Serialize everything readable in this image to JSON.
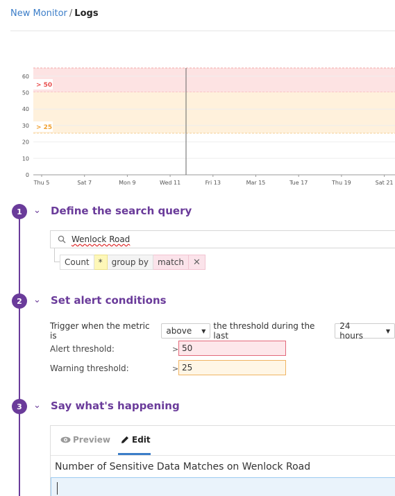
{
  "breadcrumb": {
    "parent": "New Monitor",
    "separator": "/",
    "current": "Logs"
  },
  "chart": {
    "y_ticks": [
      "0",
      "10",
      "20",
      "30",
      "40",
      "50",
      "60"
    ],
    "x_labels": [
      "Thu 5",
      "Sat 7",
      "Mon 9",
      "Wed 11",
      "Fri 13",
      "Mar 15",
      "Tue 17",
      "Thu 19",
      "Sat 21"
    ],
    "alert_label": "> 50",
    "warning_label": "> 25",
    "alert_color": "#e8504f",
    "warning_color": "#f0a030"
  },
  "chart_data": {
    "type": "line",
    "categories": [
      "Thu 5",
      "Sat 7",
      "Mon 9",
      "Wed 11",
      "Fri 13",
      "Mar 15",
      "Tue 17",
      "Thu 19",
      "Sat 21"
    ],
    "ylim": [
      0,
      65
    ],
    "series": [],
    "thresholds": {
      "alert": 50,
      "warning": 25
    }
  },
  "steps": [
    {
      "number": "1",
      "title": "Define the search query"
    },
    {
      "number": "2",
      "title": "Set alert conditions"
    },
    {
      "number": "3",
      "title": "Say what's happening"
    }
  ],
  "query": {
    "search_icon": "search-icon",
    "search_text": "Wenlock Road",
    "measure": "Count",
    "facet": "*",
    "group_by": "group by",
    "group_value": "match",
    "remove_icon": "✕"
  },
  "conditions": {
    "trigger_prefix": "Trigger when the metric is",
    "comparator": "above",
    "threshold_mid": "the threshold during the last",
    "timeframe": "24 hours",
    "caret": "▼",
    "alert_label": "Alert threshold:",
    "alert_value": "50",
    "warning_label": "Warning threshold:",
    "warning_value": "25",
    "gt": ">"
  },
  "message": {
    "preview_tab": "Preview",
    "edit_tab": "Edit",
    "title": "Number of Sensitive Data Matches on Wenlock Road",
    "body": ""
  }
}
